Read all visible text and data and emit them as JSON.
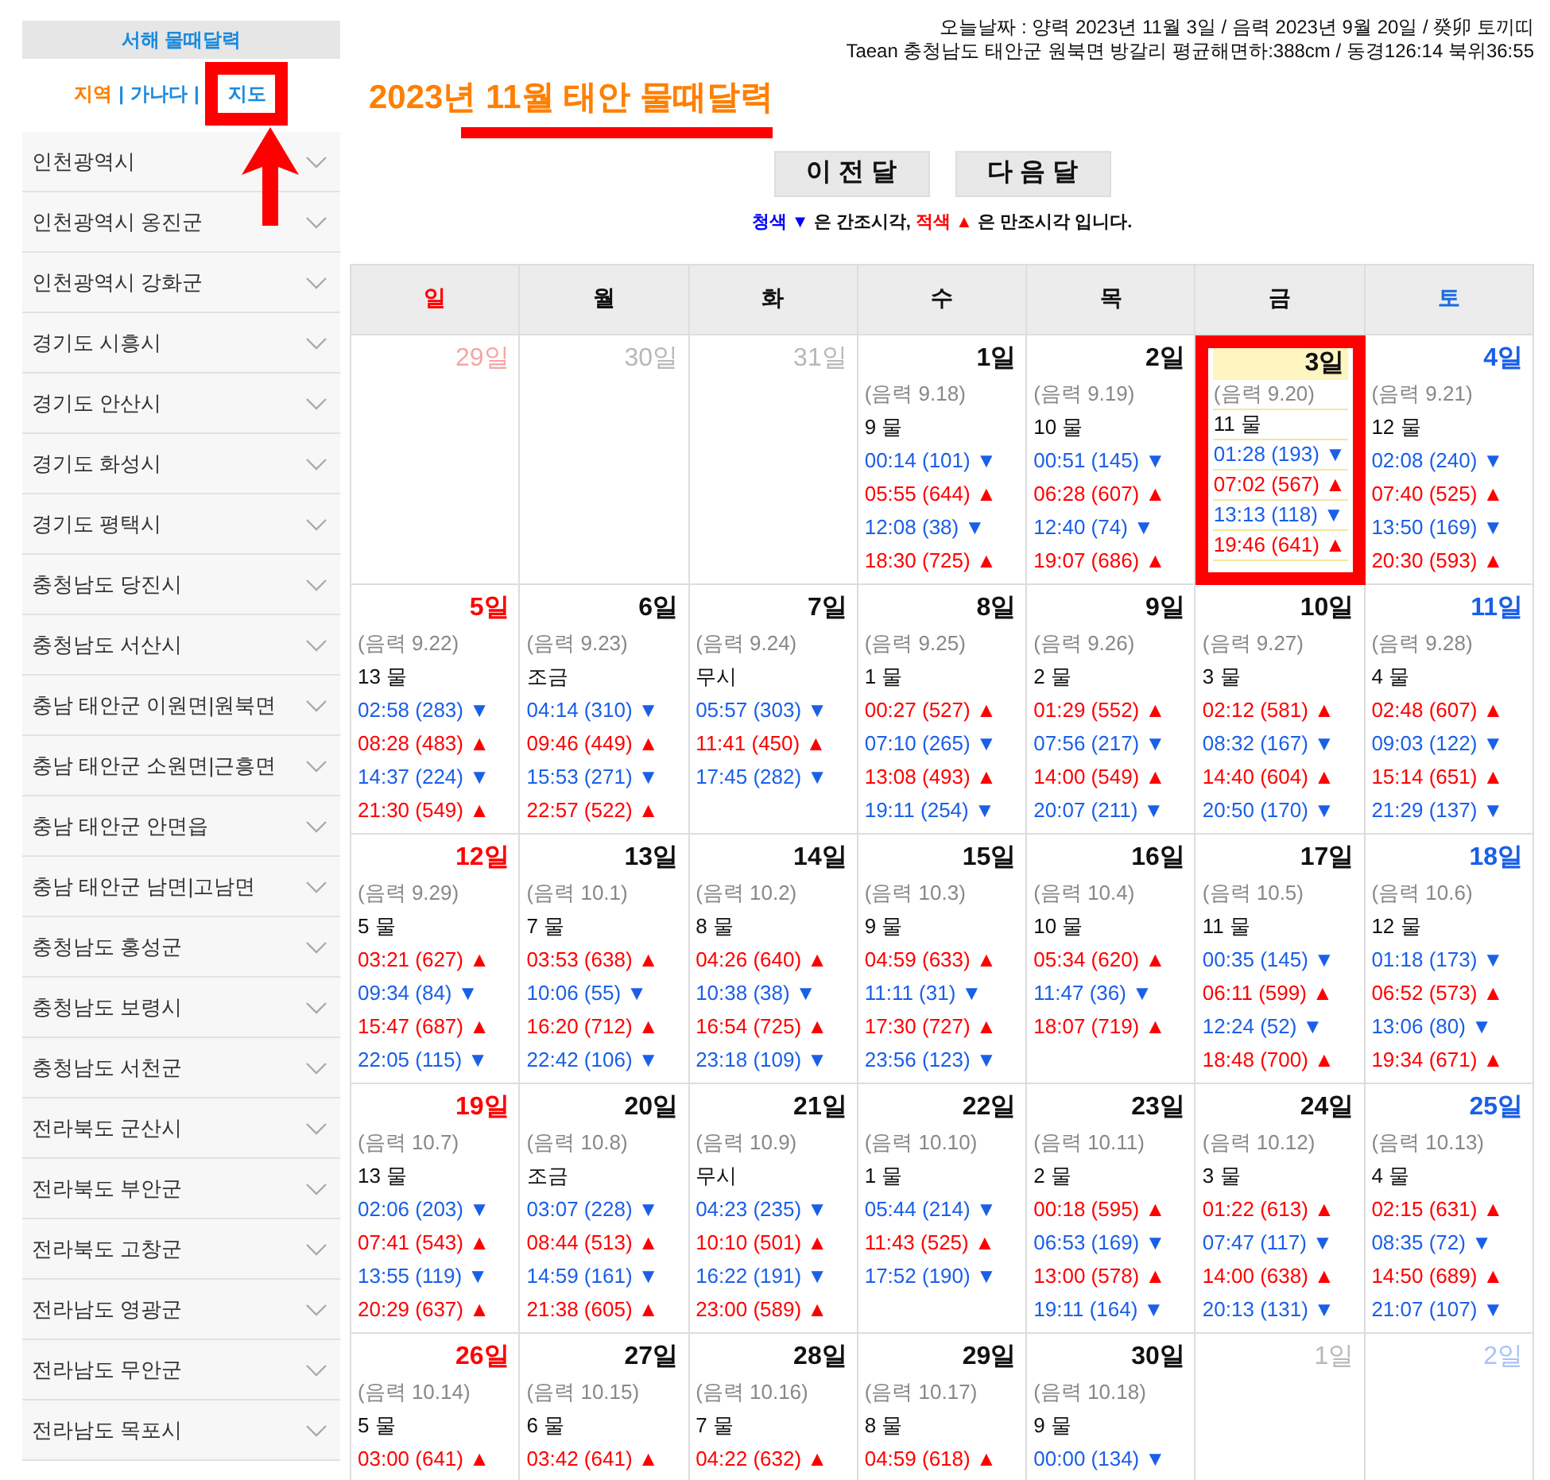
{
  "sidebar": {
    "title": "서해 물때달력",
    "arrow": true,
    "separator": "|",
    "links": [
      {
        "label": "지역",
        "selected": true,
        "marked": false
      },
      {
        "label": "가나다",
        "selected": false,
        "marked": false
      },
      {
        "label": "지도",
        "selected": false,
        "marked": true
      }
    ],
    "items": [
      "인천광역시",
      "인천광역시 옹진군",
      "인천광역시 강화군",
      "경기도 시흥시",
      "경기도 안산시",
      "경기도 화성시",
      "경기도 평택시",
      "충청남도 당진시",
      "충청남도 서산시",
      "충남 태안군 이원면|원북면",
      "충남 태안군 소원면|근흥면",
      "충남 태안군 안면읍",
      "충남 태안군 남면|고남면",
      "충청남도 홍성군",
      "충청남도 보령시",
      "충청남도 서천군",
      "전라북도 군산시",
      "전라북도 부안군",
      "전라북도 고창군",
      "전라남도 영광군",
      "전라남도 무안군",
      "전라남도 목포시"
    ]
  },
  "info": [
    "오늘날짜 : 양력 2023년 11월 3일 / 음력 2023년 9월 20일 / 癸卯 토끼띠",
    "Taean 충청남도 태안군 원북면 방갈리 평균해면하:388cm / 동경126:14 북위36:55"
  ],
  "title": {
    "text": "2023년 11월 태안 물때달력",
    "underlined": true
  },
  "buttons": [
    "이 전 달",
    "다 음 달"
  ],
  "legend": [
    {
      "text": "청색 ▼",
      "color": "#0000ff"
    },
    {
      "text": " 은 간조시각, "
    },
    {
      "text": "적색 ▲",
      "color": "#ff0000"
    },
    {
      "text": " 은 만조시각 입니다."
    }
  ],
  "weekdays": [
    "일",
    "월",
    "화",
    "수",
    "목",
    "금",
    "토"
  ],
  "weeks": [
    {
      "days": [
        {
          "day": "29일",
          "other_month": true
        },
        {
          "day": "30일",
          "other_month": true
        },
        {
          "day": "31일",
          "other_month": true
        },
        {
          "day": "1일",
          "lunar": "(음력 9.18)",
          "mul": "9 물",
          "tides": [
            {
              "kind": "low",
              "text": "00:14 (101) ▼"
            },
            {
              "kind": "high",
              "text": "05:55 (644) ▲"
            },
            {
              "kind": "low",
              "text": "12:08 (38) ▼"
            },
            {
              "kind": "high",
              "text": "18:30 (725) ▲"
            }
          ]
        },
        {
          "day": "2일",
          "lunar": "(음력 9.19)",
          "mul": "10 물",
          "tides": [
            {
              "kind": "low",
              "text": "00:51 (145) ▼"
            },
            {
              "kind": "high",
              "text": "06:28 (607) ▲"
            },
            {
              "kind": "low",
              "text": "12:40 (74) ▼"
            },
            {
              "kind": "high",
              "text": "19:07 (686) ▲"
            }
          ]
        },
        {
          "day": "3일",
          "today": true,
          "lunar": "(음력 9.20)",
          "mul": "11 물",
          "tides": [
            {
              "kind": "low",
              "text": "01:28 (193) ▼"
            },
            {
              "kind": "high",
              "text": "07:02 (567) ▲"
            },
            {
              "kind": "low",
              "text": "13:13 (118) ▼"
            },
            {
              "kind": "high",
              "text": "19:46 (641) ▲"
            }
          ]
        },
        {
          "day": "4일",
          "lunar": "(음력 9.21)",
          "mul": "12 물",
          "tides": [
            {
              "kind": "low",
              "text": "02:08 (240) ▼"
            },
            {
              "kind": "high",
              "text": "07:40 (525) ▲"
            },
            {
              "kind": "low",
              "text": "13:50 (169) ▼"
            },
            {
              "kind": "high",
              "text": "20:30 (593) ▲"
            }
          ]
        }
      ]
    },
    {
      "days": [
        {
          "day": "5일",
          "lunar": "(음력 9.22)",
          "mul": "13 물",
          "tides": [
            {
              "kind": "low",
              "text": "02:58 (283) ▼"
            },
            {
              "kind": "high",
              "text": "08:28 (483) ▲"
            },
            {
              "kind": "low",
              "text": "14:37 (224) ▼"
            },
            {
              "kind": "high",
              "text": "21:30 (549) ▲"
            }
          ]
        },
        {
          "day": "6일",
          "lunar": "(음력 9.23)",
          "mul": "조금",
          "tides": [
            {
              "kind": "low",
              "text": "04:14 (310) ▼"
            },
            {
              "kind": "high",
              "text": "09:46 (449) ▲"
            },
            {
              "kind": "low",
              "text": "15:53 (271) ▼"
            },
            {
              "kind": "high",
              "text": "22:57 (522) ▲"
            }
          ]
        },
        {
          "day": "7일",
          "lunar": "(음력 9.24)",
          "mul": "무시",
          "tides": [
            {
              "kind": "low",
              "text": "05:57 (303) ▼"
            },
            {
              "kind": "high",
              "text": "11:41 (450) ▲"
            },
            {
              "kind": "low",
              "text": "17:45 (282) ▼"
            }
          ]
        },
        {
          "day": "8일",
          "lunar": "(음력 9.25)",
          "mul": "1 물",
          "tides": [
            {
              "kind": "high",
              "text": "00:27 (527) ▲"
            },
            {
              "kind": "low",
              "text": "07:10 (265) ▼"
            },
            {
              "kind": "high",
              "text": "13:08 (493) ▲"
            },
            {
              "kind": "low",
              "text": "19:11 (254) ▼"
            }
          ]
        },
        {
          "day": "9일",
          "lunar": "(음력 9.26)",
          "mul": "2 물",
          "tides": [
            {
              "kind": "high",
              "text": "01:29 (552) ▲"
            },
            {
              "kind": "low",
              "text": "07:56 (217) ▼"
            },
            {
              "kind": "high",
              "text": "14:00 (549) ▲"
            },
            {
              "kind": "low",
              "text": "20:07 (211) ▼"
            }
          ]
        },
        {
          "day": "10일",
          "lunar": "(음력 9.27)",
          "mul": "3 물",
          "tides": [
            {
              "kind": "high",
              "text": "02:12 (581) ▲"
            },
            {
              "kind": "low",
              "text": "08:32 (167) ▼"
            },
            {
              "kind": "high",
              "text": "14:40 (604) ▲"
            },
            {
              "kind": "low",
              "text": "20:50 (170) ▼"
            }
          ]
        },
        {
          "day": "11일",
          "lunar": "(음력 9.28)",
          "mul": "4 물",
          "tides": [
            {
              "kind": "high",
              "text": "02:48 (607) ▲"
            },
            {
              "kind": "low",
              "text": "09:03 (122) ▼"
            },
            {
              "kind": "high",
              "text": "15:14 (651) ▲"
            },
            {
              "kind": "low",
              "text": "21:29 (137) ▼"
            }
          ]
        }
      ]
    },
    {
      "days": [
        {
          "day": "12일",
          "lunar": "(음력 9.29)",
          "mul": "5 물",
          "tides": [
            {
              "kind": "high",
              "text": "03:21 (627) ▲"
            },
            {
              "kind": "low",
              "text": "09:34 (84) ▼"
            },
            {
              "kind": "high",
              "text": "15:47 (687) ▲"
            },
            {
              "kind": "low",
              "text": "22:05 (115) ▼"
            }
          ]
        },
        {
          "day": "13일",
          "lunar": "(음력 10.1)",
          "mul": "7 물",
          "tides": [
            {
              "kind": "high",
              "text": "03:53 (638) ▲"
            },
            {
              "kind": "low",
              "text": "10:06 (55) ▼"
            },
            {
              "kind": "high",
              "text": "16:20 (712) ▲"
            },
            {
              "kind": "low",
              "text": "22:42 (106) ▼"
            }
          ]
        },
        {
          "day": "14일",
          "lunar": "(음력 10.2)",
          "mul": "8 물",
          "tides": [
            {
              "kind": "high",
              "text": "04:26 (640) ▲"
            },
            {
              "kind": "low",
              "text": "10:38 (38) ▼"
            },
            {
              "kind": "high",
              "text": "16:54 (725) ▲"
            },
            {
              "kind": "low",
              "text": "23:18 (109) ▼"
            }
          ]
        },
        {
          "day": "15일",
          "lunar": "(음력 10.3)",
          "mul": "9 물",
          "tides": [
            {
              "kind": "high",
              "text": "04:59 (633) ▲"
            },
            {
              "kind": "low",
              "text": "11:11 (31) ▼"
            },
            {
              "kind": "high",
              "text": "17:30 (727) ▲"
            },
            {
              "kind": "low",
              "text": "23:56 (123) ▼"
            }
          ]
        },
        {
          "day": "16일",
          "lunar": "(음력 10.4)",
          "mul": "10 물",
          "tides": [
            {
              "kind": "high",
              "text": "05:34 (620) ▲"
            },
            {
              "kind": "low",
              "text": "11:47 (36) ▼"
            },
            {
              "kind": "high",
              "text": "18:07 (719) ▲"
            }
          ]
        },
        {
          "day": "17일",
          "lunar": "(음력 10.5)",
          "mul": "11 물",
          "tides": [
            {
              "kind": "low",
              "text": "00:35 (145) ▼"
            },
            {
              "kind": "high",
              "text": "06:11 (599) ▲"
            },
            {
              "kind": "low",
              "text": "12:24 (52) ▼"
            },
            {
              "kind": "high",
              "text": "18:48 (700) ▲"
            }
          ]
        },
        {
          "day": "18일",
          "lunar": "(음력 10.6)",
          "mul": "12 물",
          "tides": [
            {
              "kind": "low",
              "text": "01:18 (173) ▼"
            },
            {
              "kind": "high",
              "text": "06:52 (573) ▲"
            },
            {
              "kind": "low",
              "text": "13:06 (80) ▼"
            },
            {
              "kind": "high",
              "text": "19:34 (671) ▲"
            }
          ]
        }
      ]
    },
    {
      "days": [
        {
          "day": "19일",
          "lunar": "(음력 10.7)",
          "mul": "13 물",
          "tides": [
            {
              "kind": "low",
              "text": "02:06 (203) ▼"
            },
            {
              "kind": "high",
              "text": "07:41 (543) ▲"
            },
            {
              "kind": "low",
              "text": "13:55 (119) ▼"
            },
            {
              "kind": "high",
              "text": "20:29 (637) ▲"
            }
          ]
        },
        {
          "day": "20일",
          "lunar": "(음력 10.8)",
          "mul": "조금",
          "tides": [
            {
              "kind": "low",
              "text": "03:07 (228) ▼"
            },
            {
              "kind": "high",
              "text": "08:44 (513) ▲"
            },
            {
              "kind": "low",
              "text": "14:59 (161) ▼"
            },
            {
              "kind": "high",
              "text": "21:38 (605) ▲"
            }
          ]
        },
        {
          "day": "21일",
          "lunar": "(음력 10.9)",
          "mul": "무시",
          "tides": [
            {
              "kind": "low",
              "text": "04:23 (235) ▼"
            },
            {
              "kind": "high",
              "text": "10:10 (501) ▲"
            },
            {
              "kind": "low",
              "text": "16:22 (191) ▼"
            },
            {
              "kind": "high",
              "text": "23:00 (589) ▲"
            }
          ]
        },
        {
          "day": "22일",
          "lunar": "(음력 10.10)",
          "mul": "1 물",
          "tides": [
            {
              "kind": "low",
              "text": "05:44 (214) ▼"
            },
            {
              "kind": "high",
              "text": "11:43 (525) ▲"
            },
            {
              "kind": "low",
              "text": "17:52 (190) ▼"
            }
          ]
        },
        {
          "day": "23일",
          "lunar": "(음력 10.11)",
          "mul": "2 물",
          "tides": [
            {
              "kind": "high",
              "text": "00:18 (595) ▲"
            },
            {
              "kind": "low",
              "text": "06:53 (169) ▼"
            },
            {
              "kind": "high",
              "text": "13:00 (578) ▲"
            },
            {
              "kind": "low",
              "text": "19:11 (164) ▼"
            }
          ]
        },
        {
          "day": "24일",
          "lunar": "(음력 10.12)",
          "mul": "3 물",
          "tides": [
            {
              "kind": "high",
              "text": "01:22 (613) ▲"
            },
            {
              "kind": "low",
              "text": "07:47 (117) ▼"
            },
            {
              "kind": "high",
              "text": "14:00 (638) ▲"
            },
            {
              "kind": "low",
              "text": "20:13 (131) ▼"
            }
          ]
        },
        {
          "day": "25일",
          "lunar": "(음력 10.13)",
          "mul": "4 물",
          "tides": [
            {
              "kind": "high",
              "text": "02:15 (631) ▲"
            },
            {
              "kind": "low",
              "text": "08:35 (72) ▼"
            },
            {
              "kind": "high",
              "text": "14:50 (689) ▲"
            },
            {
              "kind": "low",
              "text": "21:07 (107) ▼"
            }
          ]
        }
      ]
    },
    {
      "days": [
        {
          "day": "26일",
          "lunar": "(음력 10.14)",
          "mul": "5 물",
          "tides": [
            {
              "kind": "high",
              "text": "03:00 (641) ▲"
            }
          ]
        },
        {
          "day": "27일",
          "lunar": "(음력 10.15)",
          "mul": "6 물",
          "tides": [
            {
              "kind": "high",
              "text": "03:42 (641) ▲"
            }
          ]
        },
        {
          "day": "28일",
          "lunar": "(음력 10.16)",
          "mul": "7 물",
          "tides": [
            {
              "kind": "high",
              "text": "04:22 (632) ▲"
            }
          ]
        },
        {
          "day": "29일",
          "lunar": "(음력 10.17)",
          "mul": "8 물",
          "tides": [
            {
              "kind": "high",
              "text": "04:59 (618) ▲"
            }
          ]
        },
        {
          "day": "30일",
          "lunar": "(음력 10.18)",
          "mul": "9 물",
          "tides": [
            {
              "kind": "low",
              "text": "00:00 (134) ▼"
            }
          ]
        },
        {
          "day": "1일",
          "other_month": true
        },
        {
          "day": "2일",
          "other_month": true
        }
      ]
    }
  ]
}
